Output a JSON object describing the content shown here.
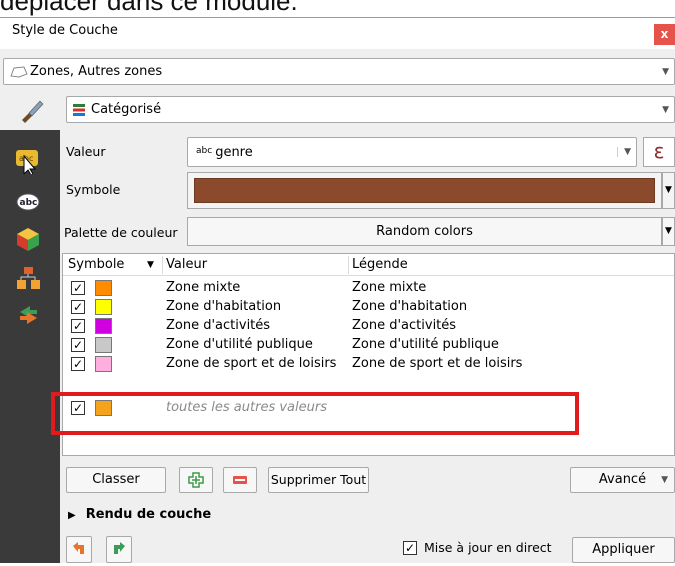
{
  "doc_caption": "déplacer dans ce module.",
  "dialog": {
    "title": "Style de Couche",
    "close_glyph": "x"
  },
  "layer_select": {
    "value": "Zones, Autres zones"
  },
  "renderer_select": {
    "value": "Catégorisé"
  },
  "sidebar": {
    "icons": [
      "abc-label-icon",
      "abc-icon",
      "3d-cube-icon",
      "diagram-icon",
      "arrow-icon"
    ]
  },
  "form": {
    "value_label": "Valeur",
    "value_field": "genre",
    "value_field_prefix": "abc",
    "epsilon_glyph": "ε",
    "symbol_label": "Symbole",
    "symbol_color": "#8a4a2b",
    "palette_label": "Palette de couleur",
    "palette_value": "Random colors"
  },
  "table": {
    "headers": {
      "symbol": "Symbole",
      "value": "Valeur",
      "legend": "Légende"
    },
    "rows": [
      {
        "color": "#ff8c00",
        "value": "Zone mixte",
        "legend": "Zone mixte"
      },
      {
        "color": "#ffff00",
        "value": "Zone d'habitation",
        "legend": "Zone d'habitation"
      },
      {
        "color": "#d000e0",
        "value": "Zone d'activités",
        "legend": "Zone d'activités"
      },
      {
        "color": "#c8c8c8",
        "value": "Zone d'utilité publique",
        "legend": "Zone d'utilité publique"
      },
      {
        "color": "#ffaee0",
        "value": "Zone de sport et de loisirs",
        "legend": "Zone de sport et de loisirs"
      },
      {
        "color": "#f5a21c",
        "value": "toutes les autres valeurs",
        "legend": ""
      }
    ]
  },
  "buttons": {
    "classify": "Classer",
    "delete_all": "Supprimer Tout",
    "advanced": "Avancé",
    "apply": "Appliquer"
  },
  "layer_rendering": "Rendu de couche",
  "live_update": "Mise à jour en direct",
  "highlight_color": "#e11b1b"
}
